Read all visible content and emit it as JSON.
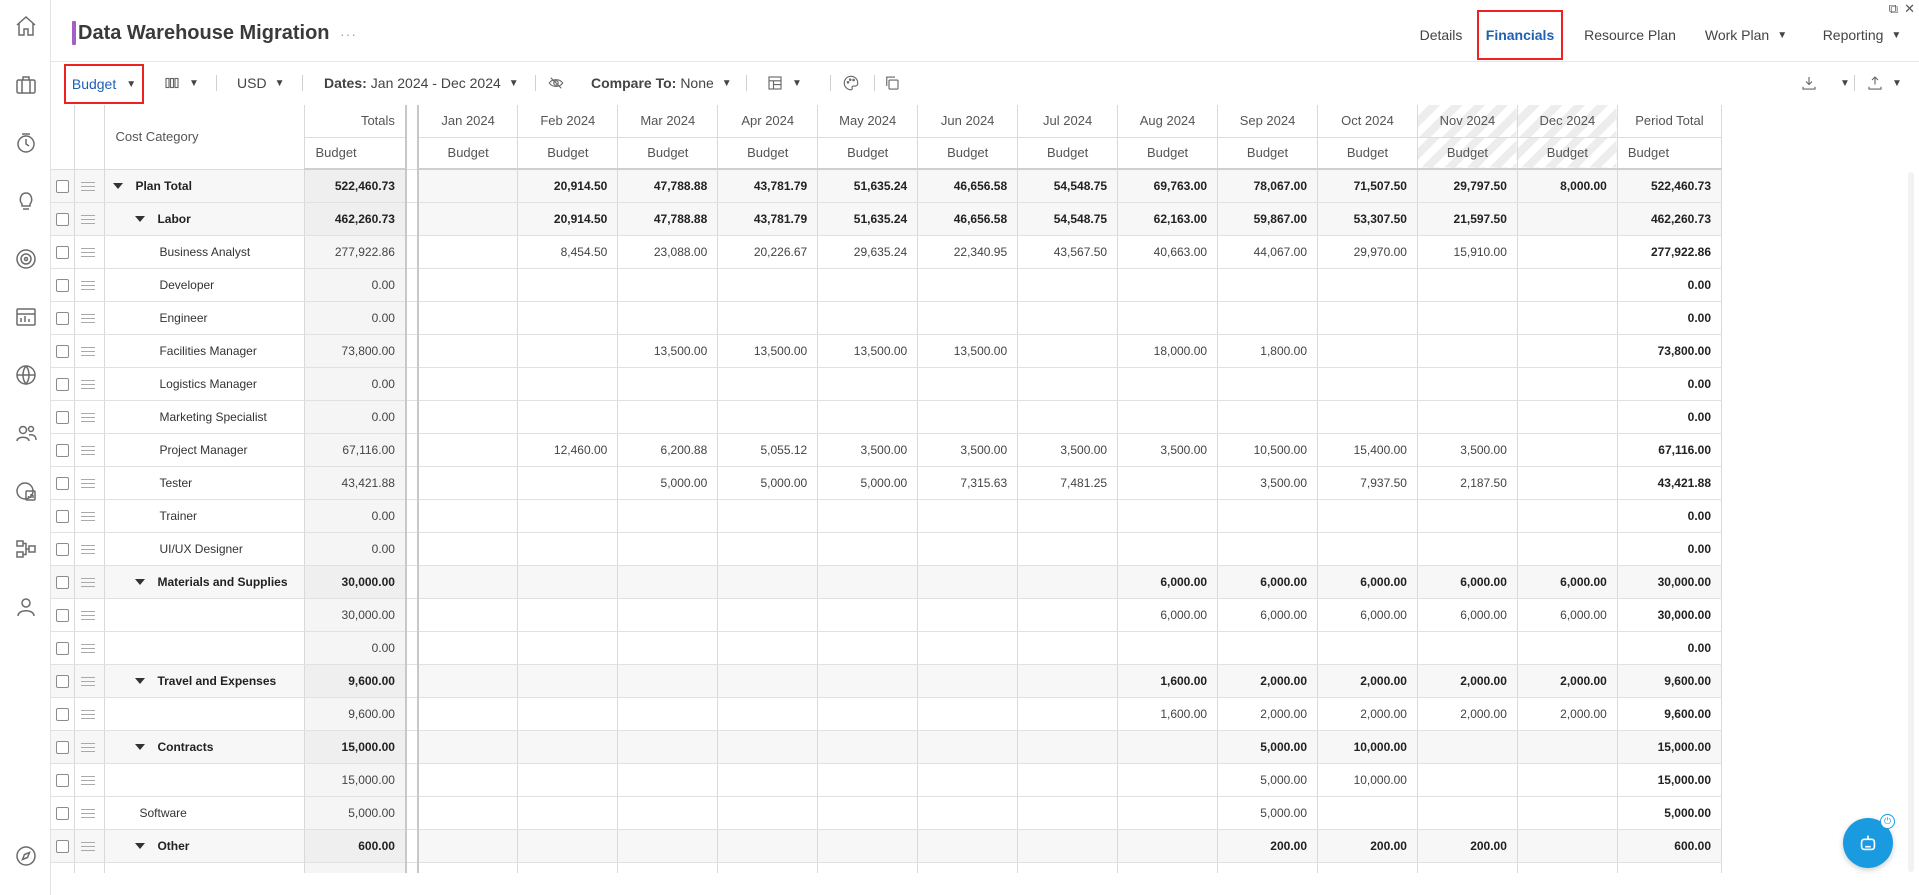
{
  "window": {
    "popout_glyph": "⧉",
    "close_glyph": "✕"
  },
  "header": {
    "title": "Data Warehouse Migration",
    "more_glyph": "···",
    "tabs": [
      {
        "label": "Details"
      },
      {
        "label": "Financials"
      },
      {
        "label": "Resource Plan"
      },
      {
        "label": "Work Plan"
      },
      {
        "label": "Reporting"
      }
    ]
  },
  "rail": {
    "icons": [
      "home-icon",
      "briefcase-icon",
      "time-history-icon",
      "lightbulb-icon",
      "target-icon",
      "dashboard-icon",
      "globe-icon",
      "people-icon",
      "reports-icon",
      "hierarchy-icon",
      "user-icon",
      "compass-icon"
    ]
  },
  "toolbar": {
    "view_label": "Budget",
    "currency": "USD",
    "dates_label": "Dates:",
    "dates_value": "Jan 2024 - Dec 2024",
    "compare_label": "Compare To:",
    "compare_value": "None"
  },
  "grid": {
    "category_header": "Cost Category",
    "totals_header": "Totals",
    "period_total_header": "Period Total",
    "sub_header": "Budget",
    "months": [
      "Jan 2024",
      "Feb 2024",
      "Mar 2024",
      "Apr 2024",
      "May 2024",
      "Jun 2024",
      "Jul 2024",
      "Aug 2024",
      "Sep 2024",
      "Oct 2024",
      "Nov 2024",
      "Dec 2024"
    ],
    "hatched_months": [
      10,
      11
    ],
    "rows": [
      {
        "name": "Plan Total",
        "level": 0,
        "group": true,
        "expanded": true,
        "total": "522,460.73",
        "months": [
          "",
          "20,914.50",
          "47,788.88",
          "43,781.79",
          "51,635.24",
          "46,656.58",
          "54,548.75",
          "69,763.00",
          "78,067.00",
          "71,507.50",
          "29,797.50",
          "8,000.00"
        ],
        "period": "522,460.73"
      },
      {
        "name": "Labor",
        "level": 1,
        "group": true,
        "expanded": true,
        "total": "462,260.73",
        "months": [
          "",
          "20,914.50",
          "47,788.88",
          "43,781.79",
          "51,635.24",
          "46,656.58",
          "54,548.75",
          "62,163.00",
          "59,867.00",
          "53,307.50",
          "21,597.50",
          ""
        ],
        "period": "462,260.73"
      },
      {
        "name": "Business Analyst",
        "level": 2,
        "group": false,
        "total": "277,922.86",
        "months": [
          "",
          "8,454.50",
          "23,088.00",
          "20,226.67",
          "29,635.24",
          "22,340.95",
          "43,567.50",
          "40,663.00",
          "44,067.00",
          "29,970.00",
          "15,910.00",
          ""
        ],
        "period": "277,922.86"
      },
      {
        "name": "Developer",
        "level": 2,
        "group": false,
        "total": "0.00",
        "months": [
          "",
          "",
          "",
          "",
          "",
          "",
          "",
          "",
          "",
          "",
          "",
          ""
        ],
        "period": "0.00"
      },
      {
        "name": "Engineer",
        "level": 2,
        "group": false,
        "total": "0.00",
        "months": [
          "",
          "",
          "",
          "",
          "",
          "",
          "",
          "",
          "",
          "",
          "",
          ""
        ],
        "period": "0.00"
      },
      {
        "name": "Facilities Manager",
        "level": 2,
        "group": false,
        "total": "73,800.00",
        "months": [
          "",
          "",
          "13,500.00",
          "13,500.00",
          "13,500.00",
          "13,500.00",
          "",
          "18,000.00",
          "1,800.00",
          "",
          "",
          ""
        ],
        "period": "73,800.00"
      },
      {
        "name": "Logistics Manager",
        "level": 2,
        "group": false,
        "total": "0.00",
        "months": [
          "",
          "",
          "",
          "",
          "",
          "",
          "",
          "",
          "",
          "",
          "",
          ""
        ],
        "period": "0.00"
      },
      {
        "name": "Marketing Specialist",
        "level": 2,
        "group": false,
        "total": "0.00",
        "months": [
          "",
          "",
          "",
          "",
          "",
          "",
          "",
          "",
          "",
          "",
          "",
          ""
        ],
        "period": "0.00"
      },
      {
        "name": "Project Manager",
        "level": 2,
        "group": false,
        "total": "67,116.00",
        "months": [
          "",
          "12,460.00",
          "6,200.88",
          "5,055.12",
          "3,500.00",
          "3,500.00",
          "3,500.00",
          "3,500.00",
          "10,500.00",
          "15,400.00",
          "3,500.00",
          ""
        ],
        "period": "67,116.00"
      },
      {
        "name": "Tester",
        "level": 2,
        "group": false,
        "total": "43,421.88",
        "months": [
          "",
          "",
          "5,000.00",
          "5,000.00",
          "5,000.00",
          "7,315.63",
          "7,481.25",
          "",
          "3,500.00",
          "7,937.50",
          "2,187.50",
          ""
        ],
        "period": "43,421.88"
      },
      {
        "name": "Trainer",
        "level": 2,
        "group": false,
        "total": "0.00",
        "months": [
          "",
          "",
          "",
          "",
          "",
          "",
          "",
          "",
          "",
          "",
          "",
          ""
        ],
        "period": "0.00"
      },
      {
        "name": "UI/UX Designer",
        "level": 2,
        "group": false,
        "total": "0.00",
        "months": [
          "",
          "",
          "",
          "",
          "",
          "",
          "",
          "",
          "",
          "",
          "",
          ""
        ],
        "period": "0.00"
      },
      {
        "name": "Materials and Supplies",
        "level": 1,
        "group": true,
        "expanded": true,
        "total": "30,000.00",
        "months": [
          "",
          "",
          "",
          "",
          "",
          "",
          "",
          "6,000.00",
          "6,000.00",
          "6,000.00",
          "6,000.00",
          "6,000.00"
        ],
        "period": "30,000.00"
      },
      {
        "name": "",
        "level": 2,
        "group": false,
        "total": "30,000.00",
        "months": [
          "",
          "",
          "",
          "",
          "",
          "",
          "",
          "6,000.00",
          "6,000.00",
          "6,000.00",
          "6,000.00",
          "6,000.00"
        ],
        "period": "30,000.00"
      },
      {
        "name": "",
        "level": 2,
        "group": false,
        "total": "0.00",
        "months": [
          "",
          "",
          "",
          "",
          "",
          "",
          "",
          "",
          "",
          "",
          "",
          ""
        ],
        "period": "0.00"
      },
      {
        "name": "Travel and Expenses",
        "level": 1,
        "group": true,
        "expanded": true,
        "total": "9,600.00",
        "months": [
          "",
          "",
          "",
          "",
          "",
          "",
          "",
          "1,600.00",
          "2,000.00",
          "2,000.00",
          "2,000.00",
          "2,000.00"
        ],
        "period": "9,600.00"
      },
      {
        "name": "",
        "level": 2,
        "group": false,
        "total": "9,600.00",
        "months": [
          "",
          "",
          "",
          "",
          "",
          "",
          "",
          "1,600.00",
          "2,000.00",
          "2,000.00",
          "2,000.00",
          "2,000.00"
        ],
        "period": "9,600.00"
      },
      {
        "name": "Contracts",
        "level": 1,
        "group": true,
        "expanded": true,
        "total": "15,000.00",
        "months": [
          "",
          "",
          "",
          "",
          "",
          "",
          "",
          "",
          "5,000.00",
          "10,000.00",
          "",
          ""
        ],
        "period": "15,000.00"
      },
      {
        "name": "",
        "level": 2,
        "group": false,
        "total": "15,000.00",
        "months": [
          "",
          "",
          "",
          "",
          "",
          "",
          "",
          "",
          "5,000.00",
          "10,000.00",
          "",
          ""
        ],
        "period": "15,000.00"
      },
      {
        "name": "Software",
        "level": "S",
        "group": false,
        "total": "5,000.00",
        "months": [
          "",
          "",
          "",
          "",
          "",
          "",
          "",
          "",
          "5,000.00",
          "",
          "",
          ""
        ],
        "period": "5,000.00"
      },
      {
        "name": "Other",
        "level": 1,
        "group": true,
        "expanded": true,
        "total": "600.00",
        "months": [
          "",
          "",
          "",
          "",
          "",
          "",
          "",
          "",
          "200.00",
          "200.00",
          "200.00",
          ""
        ],
        "period": "600.00"
      },
      {
        "name": "",
        "level": 2,
        "group": false,
        "total": "",
        "months": [
          "",
          "",
          "",
          "",
          "",
          "",
          "",
          "",
          "",
          "",
          "",
          ""
        ],
        "period": ""
      }
    ]
  },
  "fab": {
    "badge_glyph": "⏻"
  }
}
